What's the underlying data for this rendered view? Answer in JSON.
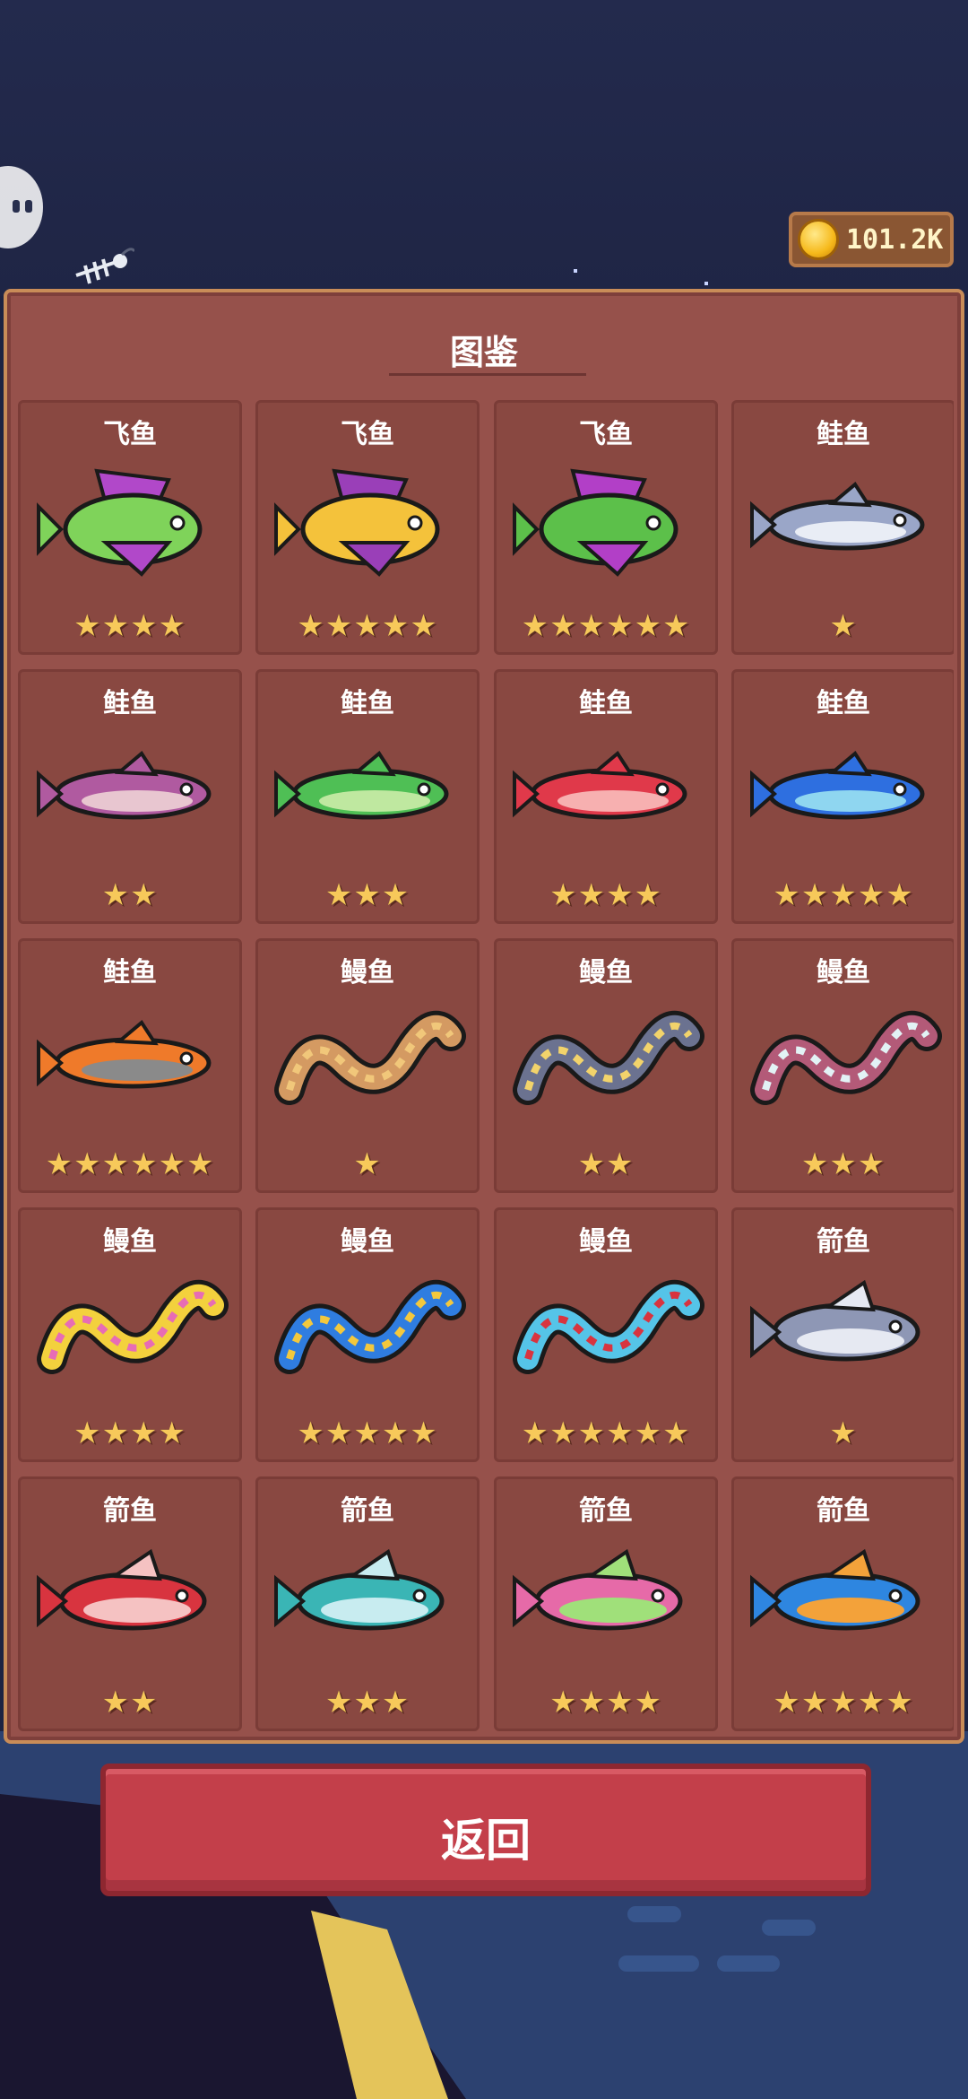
{
  "hud": {
    "coins": "101.2K"
  },
  "collection": {
    "title": "图鉴",
    "fish": [
      {
        "name": "飞鱼",
        "stars": "★★★★",
        "colors": [
          "#7fd35a",
          "#b148c9"
        ]
      },
      {
        "name": "飞鱼",
        "stars": "★★★★★",
        "colors": [
          "#f4c23b",
          "#9a3fb8"
        ]
      },
      {
        "name": "飞鱼",
        "stars": "★★★★★★",
        "colors": [
          "#5cc04a",
          "#b23fc7"
        ]
      },
      {
        "name": "鲑鱼",
        "stars": "★",
        "colors": [
          "#9aa6c8",
          "#e9edf5"
        ]
      },
      {
        "name": "鲑鱼",
        "stars": "★★",
        "colors": [
          "#b05aa0",
          "#e8c6d0"
        ]
      },
      {
        "name": "鲑鱼",
        "stars": "★★★",
        "colors": [
          "#4fbf55",
          "#bfe8a0"
        ]
      },
      {
        "name": "鲑鱼",
        "stars": "★★★★",
        "colors": [
          "#e0394a",
          "#f7b0b0"
        ]
      },
      {
        "name": "鲑鱼",
        "stars": "★★★★★",
        "colors": [
          "#2e6fe0",
          "#8fd6f0"
        ]
      },
      {
        "name": "鲑鱼",
        "stars": "★★★★★★",
        "colors": [
          "#ef7a2a",
          "#8a8a8a"
        ]
      },
      {
        "name": "鳗鱼",
        "stars": "★",
        "colors": [
          "#d49a62",
          "#f1c77a"
        ]
      },
      {
        "name": "鳗鱼",
        "stars": "★★",
        "colors": [
          "#6b7290",
          "#f2d36b"
        ]
      },
      {
        "name": "鳗鱼",
        "stars": "★★★",
        "colors": [
          "#b35a78",
          "#e2f2f5"
        ]
      },
      {
        "name": "鳗鱼",
        "stars": "★★★★",
        "colors": [
          "#f3d13d",
          "#e76cb5"
        ]
      },
      {
        "name": "鳗鱼",
        "stars": "★★★★★",
        "colors": [
          "#2f7de0",
          "#f3c83d"
        ]
      },
      {
        "name": "鳗鱼",
        "stars": "★★★★★★",
        "colors": [
          "#55c4e8",
          "#d8343f"
        ]
      },
      {
        "name": "箭鱼",
        "stars": "★",
        "colors": [
          "#8e97b5",
          "#e6e9f2"
        ]
      },
      {
        "name": "箭鱼",
        "stars": "★★",
        "colors": [
          "#d8343f",
          "#f5c2c2"
        ]
      },
      {
        "name": "箭鱼",
        "stars": "★★★",
        "colors": [
          "#3ab5b5",
          "#c8ecf0"
        ]
      },
      {
        "name": "箭鱼",
        "stars": "★★★★",
        "colors": [
          "#e66aa8",
          "#a0e07a"
        ]
      },
      {
        "name": "箭鱼",
        "stars": "★★★★★",
        "colors": [
          "#2e86e0",
          "#f3a23a"
        ]
      }
    ]
  },
  "buttons": {
    "return_label": "返回"
  }
}
